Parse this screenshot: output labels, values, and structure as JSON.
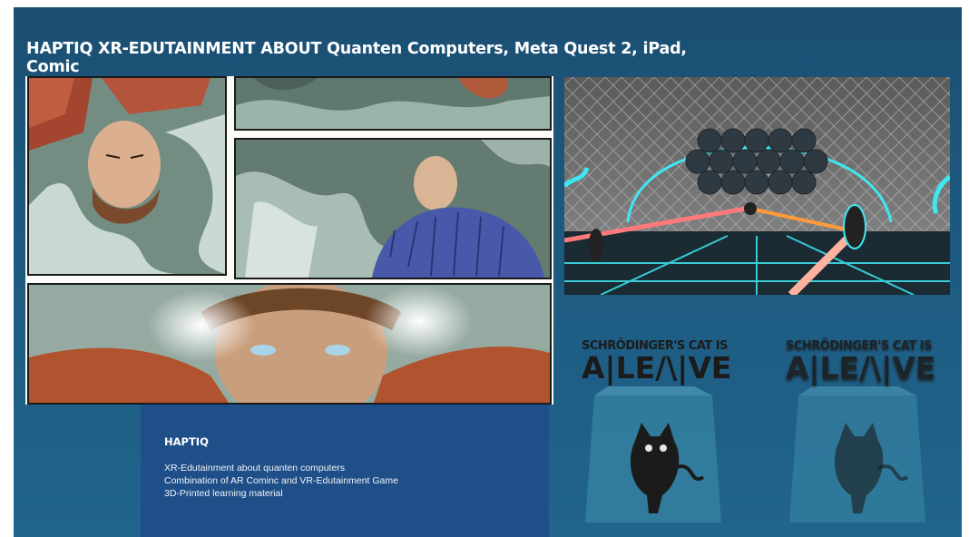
{
  "slide": {
    "title": "HAPTIQ XR-EDUTAINMENT ABOUT Quanten Computers, Meta Quest 2, iPad, Comic"
  },
  "infobox": {
    "heading": "HAPTIQ",
    "lines": [
      "XR-Edutainment about quanten computers",
      "Combination of AR Cominc and VR-Edutainment Game",
      "3D-Printed learning material"
    ]
  },
  "cubes": [
    {
      "line1": "SCHRÖDINGER'S CAT IS",
      "line2": "A|LE/\\|VE"
    },
    {
      "line1": "SCHRÖDINGER'S CAT IS",
      "line2": "A|LE/\\|VE"
    }
  ],
  "colors": {
    "slide_bg": "#1d5a80",
    "infobox_bg": "#1f4f88",
    "neon": "#3ee8f2"
  }
}
